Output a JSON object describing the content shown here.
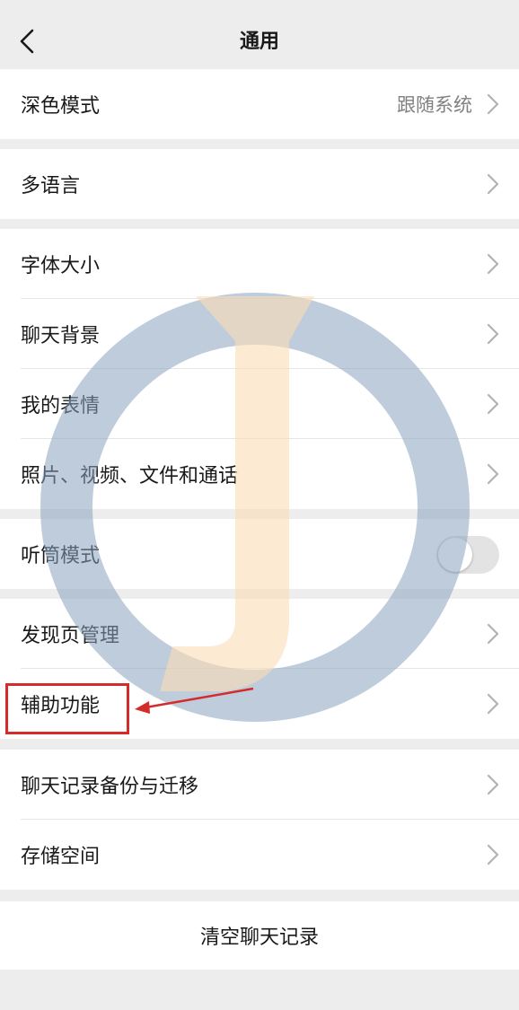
{
  "nav": {
    "title": "通用",
    "back_icon": "chevron-left-icon"
  },
  "groups": [
    {
      "items": [
        {
          "label": "深色模式",
          "value": "跟随系统"
        }
      ]
    },
    {
      "items": [
        {
          "label": "多语言"
        }
      ]
    },
    {
      "items": [
        {
          "label": "字体大小"
        },
        {
          "label": "聊天背景"
        },
        {
          "label": "我的表情"
        },
        {
          "label": "照片、视频、文件和通话"
        }
      ]
    },
    {
      "items": [
        {
          "label": "听筒模式",
          "toggle_on": false
        }
      ]
    },
    {
      "items": [
        {
          "label": "发现页管理"
        },
        {
          "label": "辅助功能",
          "highlighted": true
        }
      ]
    },
    {
      "items": [
        {
          "label": "聊天记录备份与迁移"
        },
        {
          "label": "存储空间"
        }
      ]
    }
  ],
  "clear_button": "清空聊天记录",
  "colors": {
    "background": "#ededed",
    "annotation_red": "#d42b2b",
    "watermark_blue": "#9fb2c8",
    "watermark_orange": "#fbe3c8"
  }
}
